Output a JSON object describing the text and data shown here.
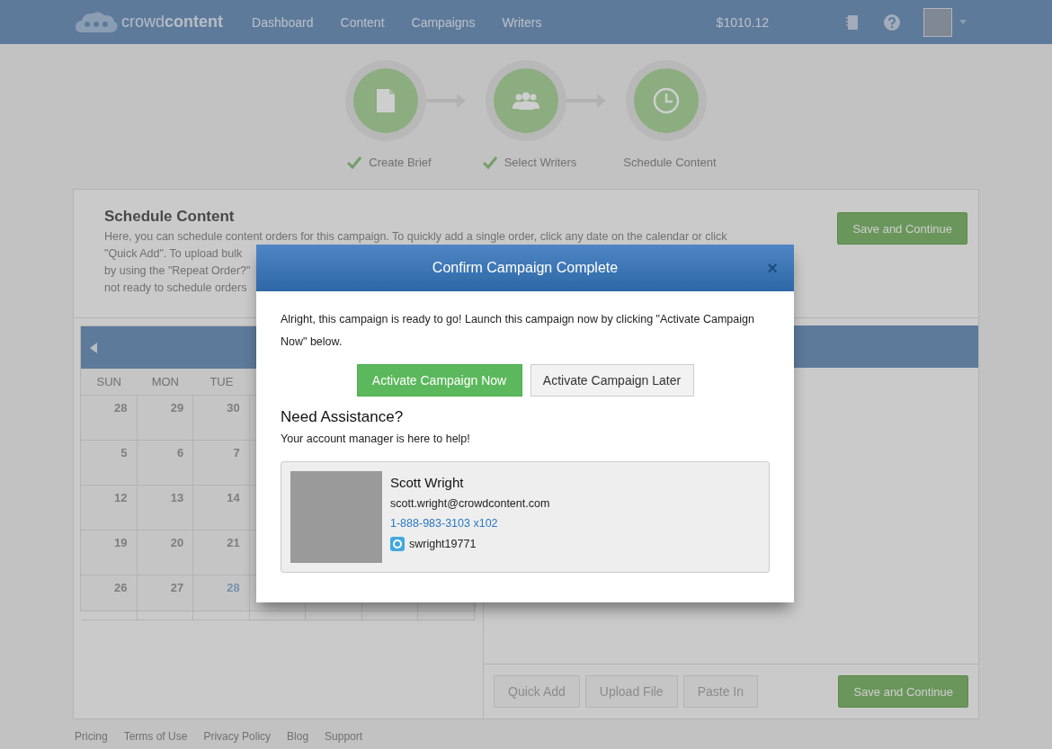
{
  "nav": {
    "logo": "crowd**content**",
    "links": [
      "Dashboard",
      "Content",
      "Campaigns",
      "Writers"
    ],
    "balance": "$1010.12"
  },
  "steps": [
    {
      "label": "Create Brief",
      "completed": true
    },
    {
      "label": "Select Writers",
      "completed": true
    },
    {
      "label": "Schedule Content",
      "completed": false
    }
  ],
  "schedule": {
    "title": "Schedule Content",
    "description_lines": [
      "Here, you can schedule content orders for this campaign. To quickly add a single order, click any date on the calendar or click",
      "\"Quick Add\". To upload bulk",
      "by using the \"Repeat Order?\"",
      "not ready to schedule orders"
    ],
    "save_button": "Save and Continue"
  },
  "calendar": {
    "weekdays": [
      "SUN",
      "MON",
      "TUE"
    ],
    "weeks": [
      [
        {
          "n": "28",
          "today": false
        },
        {
          "n": "29",
          "today": false
        },
        {
          "n": "30",
          "today": false
        }
      ],
      [
        {
          "n": "5",
          "today": false
        },
        {
          "n": "6",
          "today": false
        },
        {
          "n": "7",
          "today": false
        }
      ],
      [
        {
          "n": "12",
          "today": false
        },
        {
          "n": "13",
          "today": false
        },
        {
          "n": "14",
          "today": false
        }
      ],
      [
        {
          "n": "19",
          "today": false
        },
        {
          "n": "20",
          "today": false
        },
        {
          "n": "21",
          "today": false
        }
      ],
      [
        {
          "n": "26",
          "today": false
        },
        {
          "n": "27",
          "today": false
        },
        {
          "n": "28",
          "today": true
        }
      ]
    ]
  },
  "toolbar": {
    "buttons": [
      "Quick Add",
      "Upload File",
      "Paste In"
    ],
    "save_button": "Save and Continue"
  },
  "footer": {
    "links": [
      "Pricing",
      "Terms of Use",
      "Privacy Policy",
      "Blog",
      "Support"
    ]
  },
  "modal": {
    "title": "Confirm Campaign Complete",
    "close": "×",
    "message": "Alright, this campaign is ready to go! Launch this campaign now by clicking \"Activate Campaign Now\" below.",
    "primary_button": "Activate Campaign Now",
    "secondary_button": "Activate Campaign Later",
    "assistance_title": "Need Assistance?",
    "assistance_text": "Your account manager is here to help!",
    "manager": {
      "name": "Scott Wright",
      "email": "scott.wright@crowdcontent.com",
      "phone": "1-888-983-3103 x102",
      "skype": "swright19771"
    }
  }
}
